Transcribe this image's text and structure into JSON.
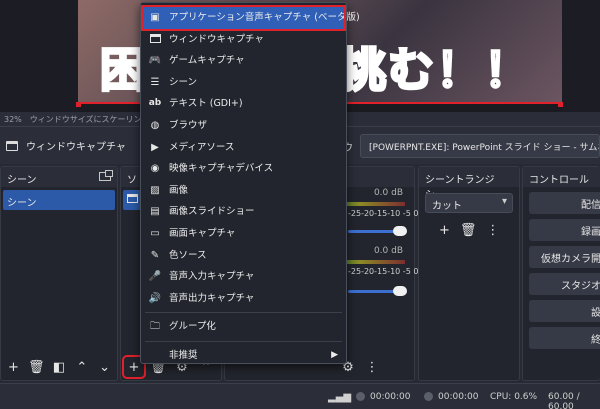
{
  "preview": {
    "left_text": "困",
    "right_text": "挑む！！"
  },
  "zoom_text": "32%　ウィンドウサイズにスケーリング表示",
  "source_toolbar": {
    "source_name": "ウィンドウキャプチャ",
    "window_label": "ウ",
    "window_value": "[POWERPNT.EXE]: PowerPoint スライド ショー - サムネ"
  },
  "scenes": {
    "title": "シーン",
    "items": [
      "シーン"
    ]
  },
  "sources": {
    "title": "ソ"
  },
  "mixer": {
    "db1": "0.0 dB",
    "db2": "0.0 dB",
    "scale": "-25-20-15-10 -5  0"
  },
  "transitions": {
    "title": "シーントランジシ...",
    "selected": "カット"
  },
  "controls": {
    "title": "コントロール",
    "buttons": [
      "配信開",
      "録画開",
      "仮想カメラ開始",
      "スタジオモ",
      "設定",
      "終了"
    ]
  },
  "status": {
    "time1": "00:00:00",
    "time2": "00:00:00",
    "cpu": "CPU: 0.6%",
    "fps": "60.00 / 60.00"
  },
  "menu": {
    "items": [
      {
        "label": "アプリケーション音声キャプチャ (ベータ版)",
        "icon": "app-audio-icon"
      },
      {
        "label": "ウィンドウキャプチャ",
        "icon": "window-icon"
      },
      {
        "label": "ゲームキャプチャ",
        "icon": "gamepad-icon"
      },
      {
        "label": "シーン",
        "icon": "list-icon"
      },
      {
        "label": "テキスト (GDI+)",
        "icon": "text-icon"
      },
      {
        "label": "ブラウザ",
        "icon": "globe-icon"
      },
      {
        "label": "メディアソース",
        "icon": "play-icon"
      },
      {
        "label": "映像キャプチャデバイス",
        "icon": "camera-icon"
      },
      {
        "label": "画像",
        "icon": "image-icon"
      },
      {
        "label": "画像スライドショー",
        "icon": "slideshow-icon"
      },
      {
        "label": "画面キャプチャ",
        "icon": "monitor-icon"
      },
      {
        "label": "色ソース",
        "icon": "brush-icon"
      },
      {
        "label": "音声入力キャプチャ",
        "icon": "microphone-icon"
      },
      {
        "label": "音声出力キャプチャ",
        "icon": "speaker-icon"
      },
      {
        "label": "グループ化",
        "icon": "folder-icon"
      },
      {
        "label": "非推奨",
        "icon": ""
      }
    ]
  }
}
